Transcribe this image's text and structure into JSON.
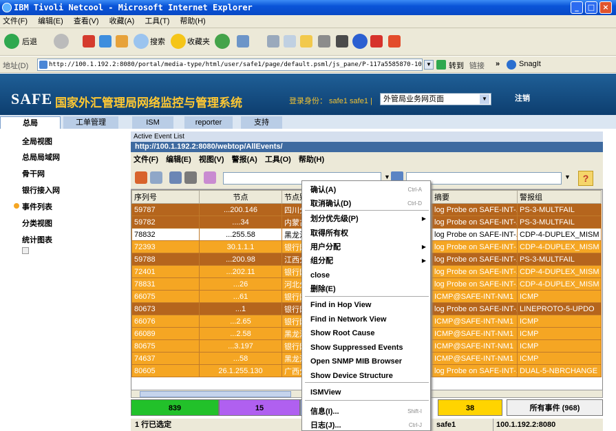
{
  "window": {
    "title": "IBM Tivoli Netcool - Microsoft Internet Explorer"
  },
  "ie_menu": [
    "文件(F)",
    "编辑(E)",
    "查看(V)",
    "收藏(A)",
    "工具(T)",
    "帮助(H)"
  ],
  "ie_toolbar": {
    "back": "后退",
    "search": "搜索",
    "favorites": "收藏夹"
  },
  "address": {
    "label": "地址(D)",
    "url": "http://100.1.192.2:8080/portal/media-type/html/user/safe1/page/default.psml/js_pane/P-117a5585870-100e2",
    "go": "转到",
    "links": "链接",
    "snagit": "SnagIt"
  },
  "app": {
    "logo": "SAFE",
    "title": "国家外汇管理局网络监控与管理系统",
    "login": "登录身份： safe1 safe1 |",
    "site": "外管局业务网页面",
    "logout": "注销"
  },
  "tabs": [
    "总局",
    "工单管理",
    "ISM",
    "reporter",
    "支持"
  ],
  "sidebar": [
    "全局视图",
    "总局局域网",
    "骨干网",
    "银行接入网",
    "事件列表",
    "分类视图",
    "统计图表"
  ],
  "events": {
    "panel_title": "Active Event List",
    "url": "http://100.1.192.2:8080/webtop/AllEvents/",
    "menu": [
      "文件(F)",
      "编辑(E)",
      "视图(V)",
      "警报(A)",
      "工具(O)",
      "帮助(H)"
    ],
    "columns": [
      "序列号",
      "节点",
      "节点别名",
      "",
      "摘要",
      "警报组"
    ],
    "rows": [
      {
        "seq": "59787",
        "node": "...200.146",
        "alias": "四川分",
        "col4": "",
        "summary": "log Probe on SAFE-INT-...",
        "group": "PS-3-MULTFAIL",
        "style": "dark"
      },
      {
        "seq": "59782",
        "node": "....34",
        "alias": "内蒙古",
        "col4": "",
        "summary": "log Probe on SAFE-INT-...",
        "group": "PS-3-MULTFAIL",
        "style": "dark"
      },
      {
        "seq": "78832",
        "node": "...255.58",
        "alias": "黑龙江",
        "col4": "",
        "summary": "log Probe on SAFE-INT-...",
        "group": "CDP-4-DUPLEX_MISM",
        "style": "sel"
      },
      {
        "seq": "72393",
        "node": "30.1.1.1",
        "alias": "银行网",
        "col4": "",
        "summary": "log Probe on SAFE-INT-...",
        "group": "CDP-4-DUPLEX_MISM",
        "style": "light"
      },
      {
        "seq": "59788",
        "node": "...200.98",
        "alias": "江西分",
        "col4": "",
        "summary": "log Probe on SAFE-INT-...",
        "group": "PS-3-MULTFAIL",
        "style": "dark"
      },
      {
        "seq": "72401",
        "node": "...202.11",
        "alias": "银行网",
        "col4": "",
        "summary": "log Probe on SAFE-INT-...",
        "group": "CDP-4-DUPLEX_MISM",
        "style": "light"
      },
      {
        "seq": "78831",
        "node": "...26",
        "alias": "河北分",
        "col4": "",
        "summary": "log Probe on SAFE-INT-...",
        "group": "CDP-4-DUPLEX_MISM",
        "style": "light"
      },
      {
        "seq": "66075",
        "node": "...61",
        "alias": "银行网",
        "col4": "",
        "summary": "ICMP@SAFE-INT-NM1",
        "group": "ICMP",
        "style": "light"
      },
      {
        "seq": "80673",
        "node": "...1",
        "alias": "银行网",
        "col4": "",
        "summary": "log Probe on SAFE-INT-...",
        "group": "LINEPROTO-5-UPDO",
        "style": "dark"
      },
      {
        "seq": "66076",
        "node": "...2.65",
        "alias": "银行网",
        "col4": "",
        "summary": "ICMP@SAFE-INT-NM1",
        "group": "ICMP",
        "style": "light"
      },
      {
        "seq": "66089",
        "node": "...2.58",
        "alias": "黑龙江",
        "col4": "",
        "summary": "ICMP@SAFE-INT-NM1",
        "group": "ICMP",
        "style": "light"
      },
      {
        "seq": "80675",
        "node": "...3.197",
        "alias": "银行网",
        "col4": "",
        "summary": "ICMP@SAFE-INT-NM1",
        "group": "ICMP",
        "style": "light"
      },
      {
        "seq": "74637",
        "node": "...58",
        "alias": "黑龙江",
        "col4": "",
        "summary": "ICMP@SAFE-INT-NM1",
        "group": "ICMP",
        "style": "light"
      },
      {
        "seq": "80605",
        "node": "26.1.255.130",
        "alias": "广西分",
        "col4": "",
        "summary": "log Probe on SAFE-INT-...",
        "group": "DUAL-5-NBRCHANGE",
        "style": "light"
      }
    ],
    "summary": [
      {
        "count": "839",
        "color": "#22c12a"
      },
      {
        "count": "15",
        "color": "#b060f0"
      },
      {
        "count": "38",
        "color": "#ffd400"
      },
      {
        "count": "所有事件 (968)",
        "color": "#f0f0f0"
      }
    ],
    "status_left": "1 行已选定",
    "status_user": "safe1",
    "status_host": "100.1.192.2:8080"
  },
  "context_menu": {
    "items": [
      {
        "label": "确认(A)",
        "shortcut": "Ctrl-A"
      },
      {
        "label": "取消确认(D)",
        "shortcut": "Ctrl-D"
      },
      {
        "label": "划分优先级(P)",
        "submenu": true
      },
      {
        "label": "取得所有权"
      },
      {
        "label": "用户分配",
        "submenu": true
      },
      {
        "label": "组分配",
        "submenu": true
      },
      {
        "label": "close"
      },
      {
        "label": "删除(E)"
      },
      {
        "label": "Find in Hop View"
      },
      {
        "label": "Find in Network View"
      },
      {
        "label": "Show Root Cause"
      },
      {
        "label": "Show Suppressed Events"
      },
      {
        "label": "Open SNMP MIB Browser"
      },
      {
        "label": "Show Device Structure"
      },
      {
        "label": "ISMView"
      },
      {
        "label": "信息(I)...",
        "shortcut": "Shift-I"
      },
      {
        "label": "日志(J)...",
        "shortcut": "Ctrl-J"
      }
    ]
  },
  "colors": {
    "row_dark": "#b5651d",
    "row_light": "#f5a623",
    "row_sel": "#ffffff",
    "header_blue": "#0d3e6f"
  }
}
